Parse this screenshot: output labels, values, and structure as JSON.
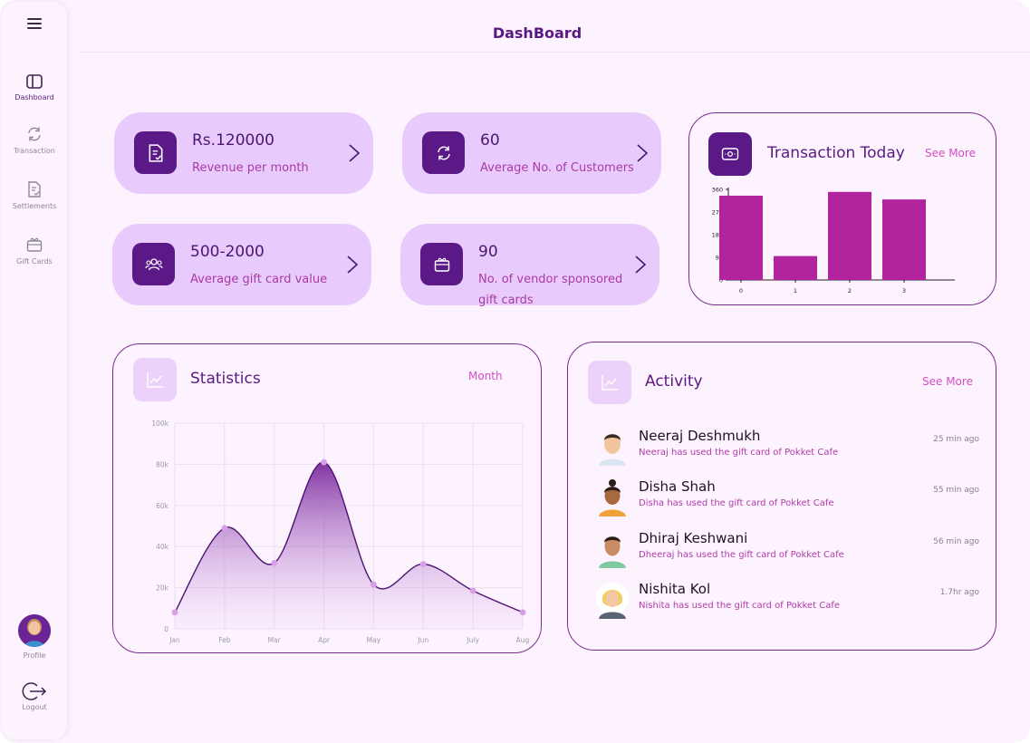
{
  "header": {
    "title": "DashBoard"
  },
  "sidebar": {
    "items": [
      {
        "label": "Dashboard",
        "icon": "dashboard-icon",
        "active": true
      },
      {
        "label": "Transaction",
        "icon": "refresh-icon",
        "active": false
      },
      {
        "label": "Settlements",
        "icon": "document-check-icon",
        "active": false
      },
      {
        "label": "Gift Cards",
        "icon": "gift-icon",
        "active": false
      }
    ],
    "profile_label": "Profile",
    "logout_label": "Logout"
  },
  "kpis": [
    {
      "value": "Rs.120000",
      "label": "Revenue per month",
      "icon": "document-check-icon"
    },
    {
      "value": "60",
      "label": "Average No. of Customers",
      "icon": "refresh-icon"
    },
    {
      "value": "500-2000",
      "label": "Average gift card value",
      "icon": "users-icon"
    },
    {
      "value": "90",
      "label_line1": "No. of vendor sponsored",
      "label_line2": "gift cards",
      "icon": "gift-icon"
    }
  ],
  "transaction_today": {
    "title": "Transaction Today",
    "see_more": "See More",
    "icon": "wallet-icon"
  },
  "statistics": {
    "title": "Statistics",
    "period": "Month",
    "icon": "chart-line-icon"
  },
  "activity": {
    "title": "Activity",
    "see_more": "See More",
    "icon": "chart-line-icon",
    "items": [
      {
        "name": "Neeraj Deshmukh",
        "desc": "Neeraj has used the gift card of Pokket Cafe",
        "time": "25 min ago"
      },
      {
        "name": "Disha Shah",
        "desc": "Disha has used the gift card of Pokket Cafe",
        "time": "55 min ago"
      },
      {
        "name": "Dhiraj Keshwani",
        "desc": "Dheeraj has used the gift card of Pokket Cafe",
        "time": "56 min ago"
      },
      {
        "name": "Nishita Kol",
        "desc": "Nishita has used the gift card of Pokket Cafe",
        "time": "1.7hr ago"
      }
    ]
  },
  "colors": {
    "accent": "#5b1987",
    "card": "#e8cbfc",
    "bar": "#b2249e",
    "link": "#d24fc0",
    "background": "#fcf3fe"
  },
  "chart_data": [
    {
      "type": "bar",
      "categories": [
        "0",
        "1",
        "2",
        "3"
      ],
      "values": [
        335,
        95,
        350,
        320
      ],
      "ylim": [
        0,
        360
      ],
      "yticks": [
        "0",
        "90",
        "180",
        "270",
        "360"
      ],
      "grid": false
    },
    {
      "type": "area",
      "categories": [
        "Jan",
        "Feb",
        "Mar",
        "Apr",
        "May",
        "Jun",
        "July",
        "Aug"
      ],
      "values": [
        8000,
        49000,
        32000,
        81000,
        21500,
        31500,
        18500,
        8000
      ],
      "ylim": [
        0,
        100000
      ],
      "yticks": [
        "0",
        "20k",
        "40k",
        "60k",
        "80k",
        "100k"
      ],
      "grid": true
    }
  ]
}
